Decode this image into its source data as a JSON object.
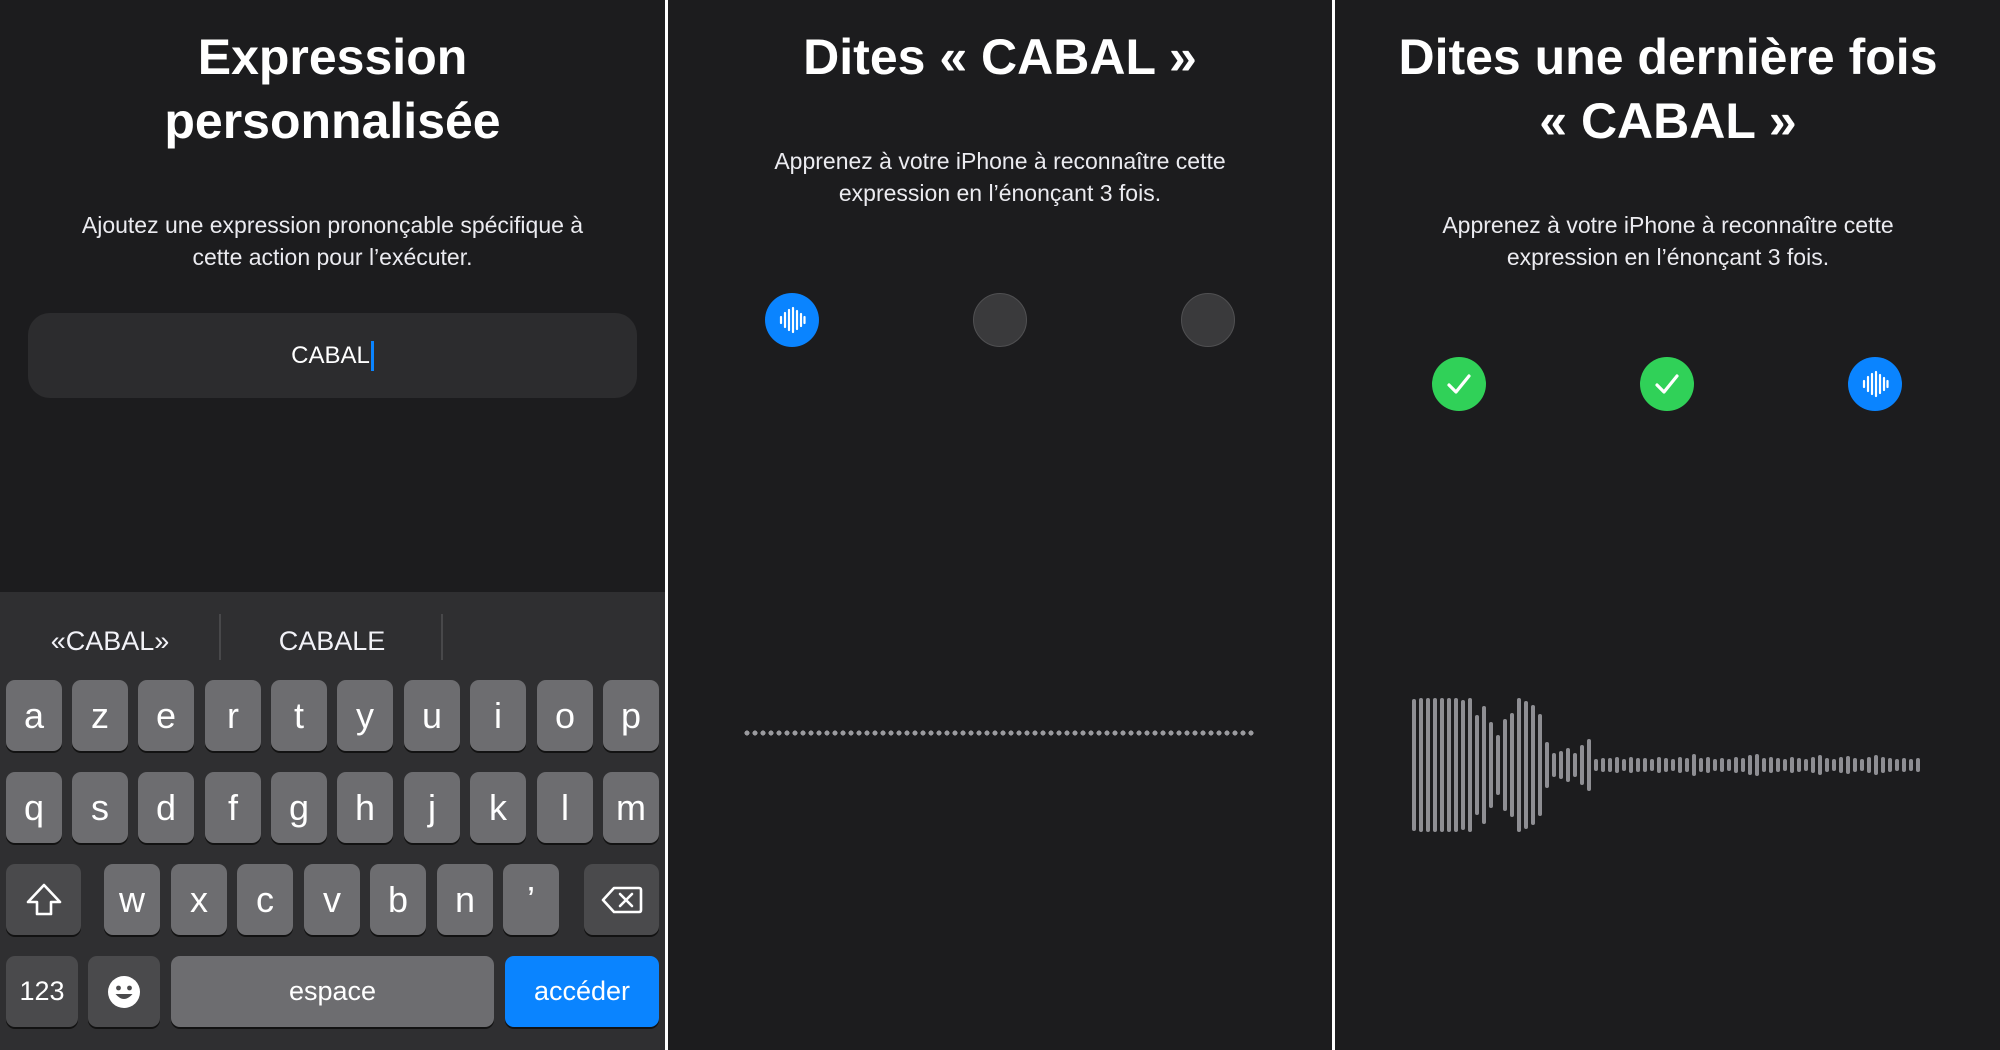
{
  "screen1": {
    "title_line1": "Expression",
    "title_line2": "personnalisée",
    "description_line1": "Ajoutez une expression prononçable spécifique à",
    "description_line2": "cette action pour l’exécuter.",
    "input_value": "CABAL",
    "suggestions": [
      "«CABAL»",
      "CABALE"
    ],
    "keyboard": {
      "row1": [
        "a",
        "z",
        "e",
        "r",
        "t",
        "y",
        "u",
        "i",
        "o",
        "p"
      ],
      "row2": [
        "q",
        "s",
        "d",
        "f",
        "g",
        "h",
        "j",
        "k",
        "l",
        "m"
      ],
      "row3": [
        "w",
        "x",
        "c",
        "v",
        "b",
        "n",
        "’"
      ],
      "numbers_key": "123",
      "space_key": "espace",
      "go_key": "accéder",
      "shift_icon": "shift-icon",
      "delete_icon": "delete-icon",
      "emoji_icon": "emoji-icon"
    }
  },
  "screen2": {
    "title": "Dites « CABAL »",
    "description_line1": "Apprenez à votre iPhone à reconnaître cette",
    "description_line2": "expression en l’énonçant 3 fois.",
    "steps": [
      "active",
      "idle",
      "idle"
    ],
    "waveform_state": "silent"
  },
  "screen3": {
    "title_line1": "Dites une dernière fois",
    "title_line2": "« CABAL »",
    "description_line1": "Apprenez à votre iPhone à reconnaître cette",
    "description_line2": "expression en l’énonçant 3 fois.",
    "steps": [
      "done",
      "done",
      "active"
    ],
    "waveform_state": "recording"
  },
  "colors": {
    "background": "#1c1c1e",
    "accent_blue": "#0a84ff",
    "success_green": "#30d158",
    "key": "#6d6d70",
    "keyboard_bg": "#2f2f31"
  }
}
